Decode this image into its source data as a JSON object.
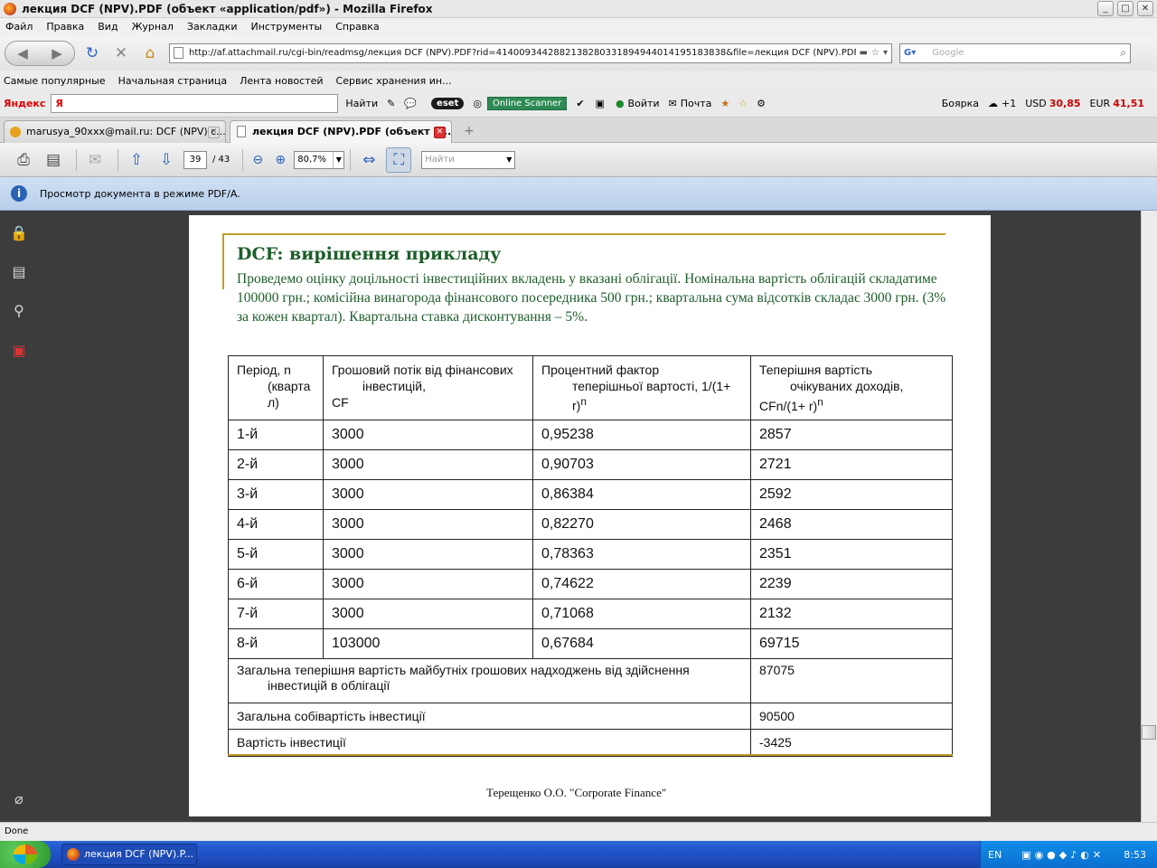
{
  "window": {
    "title": "лекция DCF (NPV).PDF (объект «application/pdf») - Mozilla Firefox",
    "min": "_",
    "max": "□",
    "close": "✕"
  },
  "menu": [
    "Файл",
    "Правка",
    "Вид",
    "Журнал",
    "Закладки",
    "Инструменты",
    "Справка"
  ],
  "nav": {
    "url": "http://af.attachmail.ru/cgi-bin/readmsg/лекция DCF (NPV).PDF?rid=4140093442882138280331894944014195183838&file=лекция DCF (NPV).PDF&i",
    "search_placeholder": "Google"
  },
  "bookmarks": [
    "Самые популярные",
    "Начальная страница",
    "Лента новостей",
    "Сервис хранения ин..."
  ],
  "yandex": {
    "logo": "Яндекс",
    "input_value": "Я",
    "find": "Найти",
    "eset": "eset",
    "online_scanner": "Online Scanner",
    "login": "Войти",
    "mail": "Почта",
    "city": "Боярка",
    "weather": "+1",
    "usd_label": "USD",
    "usd_value": "30,85",
    "eur_label": "EUR",
    "eur_value": "41,51"
  },
  "tabs": [
    {
      "label": "marusya_90xxx@mail.ru: DCF (NPV) с...",
      "active": false
    },
    {
      "label": "лекция DCF (NPV).PDF (объект «...",
      "active": true
    }
  ],
  "pdf_toolbar": {
    "page": "39",
    "total": "/ 43",
    "zoom": "80,7%",
    "find_placeholder": "Найти"
  },
  "infobar": {
    "text": "Просмотр документа в режиме PDF/A."
  },
  "document": {
    "title": "DCF: вирішення прикладу",
    "body": "Проведемо оцінку доцільності інвестиційних вкладень  у вказані облігації. Номінальна вартість облігацій складатиме 100000 грн.; комісійна винагорода фінансового посередника 500 грн.; квартальна сума відсотків складає 3000 грн. (3% за кожен квартал).   Квартальна ставка дисконтування – 5%.",
    "table": {
      "headers": [
        {
          "first": "Період, n",
          "rest": "(кварта л)",
          "tail": ""
        },
        {
          "first": "Грошовий потік від фінансових",
          "rest": "інвестицій,",
          "tail": "CF"
        },
        {
          "first": "Процентний фактор",
          "rest": "теперішньої вартості, 1/(1+ r)",
          "tail": ""
        },
        {
          "first": "Теперішня вартість",
          "rest": "очікуваних доходів,",
          "tail": "CFn/(1+ r)"
        }
      ],
      "sup": "n",
      "rows": [
        {
          "period": "1-й",
          "cf": "3000",
          "factor": "0,95238",
          "pv": "2857"
        },
        {
          "period": "2-й",
          "cf": "3000",
          "factor": "0,90703",
          "pv": "2721"
        },
        {
          "period": "3-й",
          "cf": "3000",
          "factor": "0,86384",
          "pv": "2592"
        },
        {
          "period": "4-й",
          "cf": "3000",
          "factor": "0,82270",
          "pv": "2468"
        },
        {
          "period": "5-й",
          "cf": "3000",
          "factor": "0,78363",
          "pv": "2351"
        },
        {
          "period": "6-й",
          "cf": "3000",
          "factor": "0,74622",
          "pv": "2239"
        },
        {
          "period": "7-й",
          "cf": "3000",
          "factor": "0,71068",
          "pv": "2132"
        },
        {
          "period": "8-й",
          "cf": "103000",
          "factor": "0,67684",
          "pv": "69715"
        }
      ],
      "summary": [
        {
          "first": "Загальна теперішня вартість майбутніх грошових надходжень від здійснення",
          "rest": "інвестицій в облігації",
          "value": "87075"
        },
        {
          "first": "Загальна собівартість інвестиції",
          "rest": "",
          "value": "90500"
        },
        {
          "first": "Вартість інвестиції",
          "rest": "",
          "value": "-3425"
        }
      ]
    },
    "footer": "Терещенко О.О.  \"Corporate Finance\""
  },
  "status": "Done",
  "taskbar": {
    "task": "лекция DCF (NPV).P...",
    "lang": "EN",
    "clock": "8:53"
  }
}
